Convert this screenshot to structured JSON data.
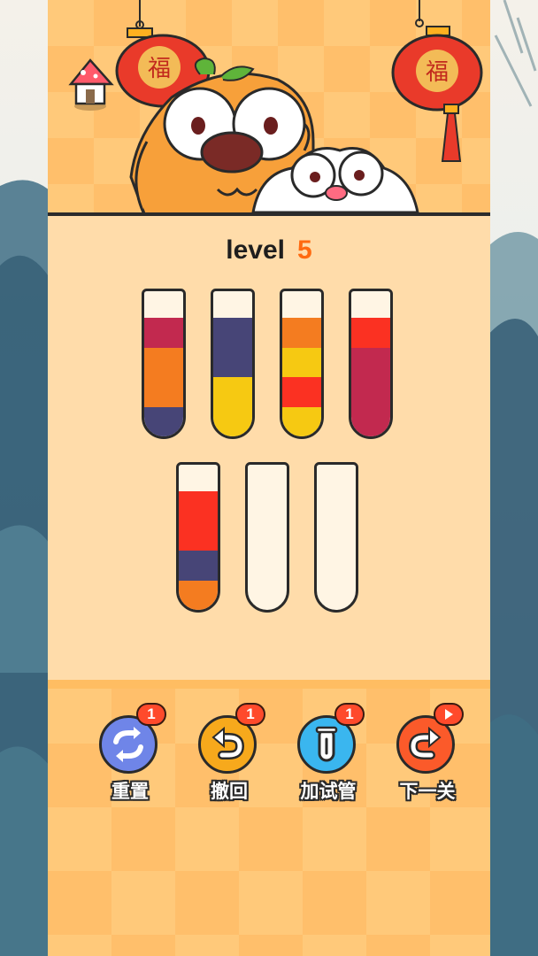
{
  "header": {
    "lantern_char": "福"
  },
  "level": {
    "word": "level",
    "number": "5"
  },
  "tubes": [
    {
      "id": 1,
      "segments": [
        "#c2294f",
        "#f47c20",
        "#f47c20",
        "#474577"
      ]
    },
    {
      "id": 2,
      "segments": [
        "#474577",
        "#474577",
        "#f6c912",
        "#f6c912"
      ]
    },
    {
      "id": 3,
      "segments": [
        "#f47c20",
        "#f6c912",
        "#fb3122",
        "#f6c912"
      ]
    },
    {
      "id": 4,
      "segments": [
        "#fb3122",
        "#c2294f",
        "#c2294f",
        "#c2294f"
      ]
    },
    {
      "id": 5,
      "segments": [
        "#fb3122",
        "#fb3122",
        "#474577",
        "#f47c20"
      ]
    },
    {
      "id": 6,
      "segments": []
    },
    {
      "id": 7,
      "segments": []
    }
  ],
  "controls": {
    "reset": {
      "label": "重置",
      "badge": "1",
      "color": "#6f85e8",
      "icon": "refresh-icon"
    },
    "undo": {
      "label": "撤回",
      "badge": "1",
      "color": "#f7a91c",
      "icon": "undo-icon"
    },
    "add_tube": {
      "label": "加试管",
      "badge": "1",
      "color": "#3ab6ef",
      "icon": "test-tube-icon"
    },
    "next_level": {
      "label": "下一关",
      "badge_icon": "video-play-icon",
      "color": "#fb5a2a",
      "icon": "redo-icon"
    }
  },
  "colors": {
    "accent": "#ff6a10",
    "panel": "#ffdcaa"
  }
}
